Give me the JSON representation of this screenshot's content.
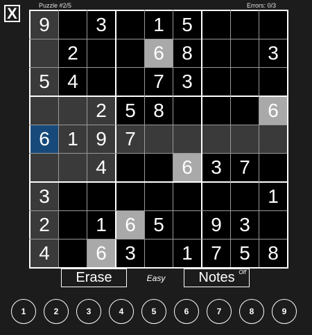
{
  "header": {
    "close_label": "X",
    "puzzle_label": "Puzzle #2/5",
    "errors_label": "Errors: 0/3"
  },
  "board": {
    "cells": [
      [
        "9",
        "",
        "3",
        "",
        "1",
        "5",
        "",
        "",
        ""
      ],
      [
        "",
        "2",
        "",
        "",
        "6",
        "8",
        "",
        "",
        "3"
      ],
      [
        "5",
        "4",
        "",
        "",
        "7",
        "3",
        "",
        "",
        ""
      ],
      [
        "",
        "",
        "2",
        "5",
        "8",
        "",
        "",
        "",
        "6"
      ],
      [
        "6",
        "1",
        "9",
        "7",
        "",
        "",
        "",
        "",
        ""
      ],
      [
        "",
        "",
        "4",
        "",
        "",
        "6",
        "3",
        "7",
        ""
      ],
      [
        "3",
        "",
        "",
        "",
        "",
        "",
        "",
        "",
        "1"
      ],
      [
        "2",
        "",
        "1",
        "6",
        "5",
        "",
        "9",
        "3",
        ""
      ],
      [
        "4",
        "",
        "6",
        "3",
        "",
        "1",
        "7",
        "5",
        "8"
      ]
    ],
    "selected": [
      4,
      0
    ],
    "colors": {
      "background": "#1c1c1c",
      "cell_empty": "#000000",
      "highlight_related": "#3a3a3a",
      "highlight_same_number": "#a9a9a9",
      "selected": "#174a7a",
      "grid_thin": "#9a9a9a",
      "grid_thick": "#ffffff"
    }
  },
  "controls": {
    "erase_label": "Erase",
    "difficulty_label": "Easy",
    "notes_label": "Notes",
    "notes_state": "Off"
  },
  "numpad": [
    "1",
    "2",
    "3",
    "4",
    "5",
    "6",
    "7",
    "8",
    "9"
  ]
}
